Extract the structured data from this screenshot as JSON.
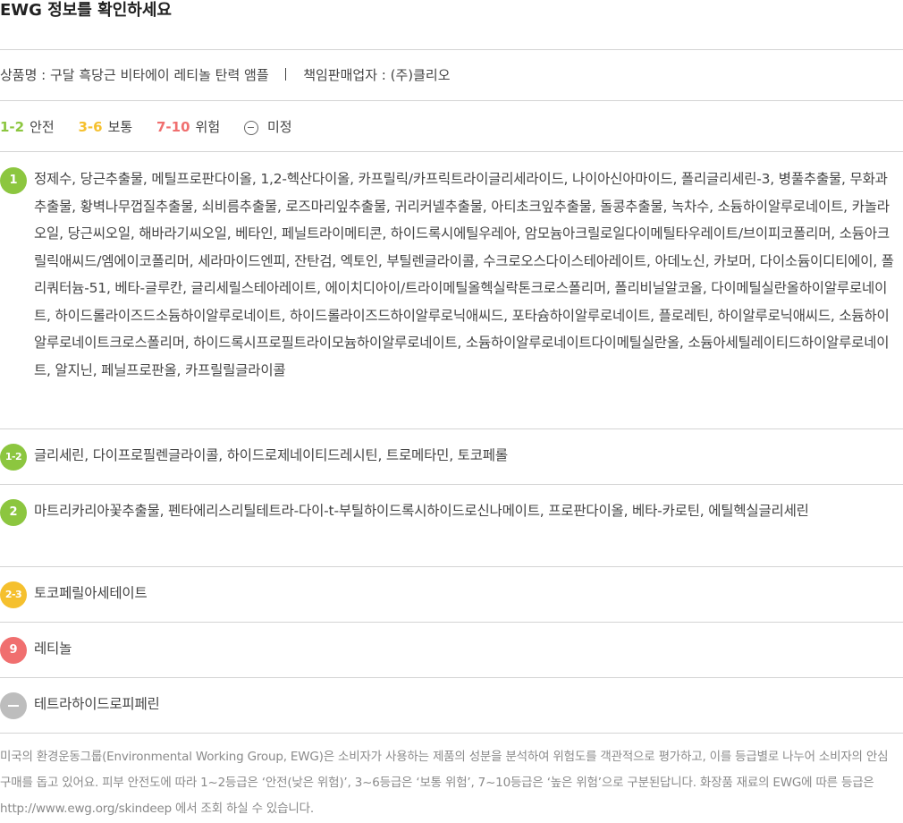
{
  "title": "EWG 정보를 확인하세요",
  "product": {
    "name": "상품명 : 구달 흑당근 비타에이 레티놀 탄력 앰플",
    "seller": "책임판매업자 : (주)클리오"
  },
  "legend": [
    {
      "range": "1-2",
      "label": "안전",
      "color": "#8cc63f"
    },
    {
      "range": "3-6",
      "label": "보통",
      "color": "#f5c02e"
    },
    {
      "range": "7-10",
      "label": "위험",
      "color": "#f06f6f"
    },
    {
      "range": "",
      "label": "미정",
      "color": "#666666",
      "icon": "minus-circle-icon"
    }
  ],
  "groups": [
    {
      "grade": "1",
      "color": "#8cc63f",
      "ingredients": "정제수, 당근추출물, 메틸프로판다이올, 1,2-헥산다이올, 카프릴릭/카프릭트라이글리세라이드, 나이아신아마이드, 폴리글리세린-3, 병풀추출물, 무화과추출물, 황벽나무껍질추출물, 쇠비름추출물, 로즈마리잎추출물, 귀리커넬추출물, 아티초크잎추출물, 돌콩추출물, 녹차수, 소듐하이알루로네이트, 카놀라오일, 당근씨오일, 해바라기씨오일, 베타인, 페닐트라이메티콘, 하이드록시에틸우레아, 암모늄아크릴로일다이메틸타우레이트/브이피코폴리머, 소듐아크릴릭애씨드/엠에이코폴리머, 세라마이드엔피, 잔탄검, 엑토인, 부틸렌글라이콜, 수크로오스다이스테아레이트, 아데노신, 카보머, 다이소듐이디티에이, 폴리쿼터늄-51, 베타-글루칸, 글리세릴스테아레이트, 에이치디아이/트라이메틸올헥실락톤크로스폴리머, 폴리비닐알코올, 다이메틸실란올하이알루로네이트, 하이드롤라이즈드소듐하이알루로네이트, 하이드롤라이즈드하이알루로닉애씨드, 포타슘하이알루로네이트, 플로레틴, 하이알루로닉애씨드, 소듐하이알루로네이트크로스폴리머, 하이드록시프로필트라이모늄하이알루로네이트, 소듐하이알루로네이트다이메틸실란올, 소듐아세틸레이티드하이알루로네이트, 알지닌, 페닐프로판올, 카프릴릴글라이콜"
    },
    {
      "grade": "1-2",
      "color": "#8cc63f",
      "ingredients": "글리세린, 다이프로필렌글라이콜, 하이드로제네이티드레시틴, 트로메타민, 토코페롤"
    },
    {
      "grade": "2",
      "color": "#8cc63f",
      "ingredients": "마트리카리아꽃추출물, 펜타에리스리틸테트라-다이-t-부틸하이드록시하이드로신나메이트, 프로판다이올, 베타-카로틴, 에틸헥실글리세린"
    },
    {
      "grade": "2-3",
      "color": "#f5c02e",
      "ingredients": "토코페릴아세테이트"
    },
    {
      "grade": "9",
      "color": "#f06f6f",
      "ingredients": "레티놀"
    },
    {
      "grade": "",
      "color": "#bdbdbd",
      "icon": "minus-icon",
      "ingredients": "테트라하이드로피페린"
    }
  ],
  "footnote": "미국의 환경운동그룹(Environmental Working Group, EWG)은 소비자가 사용하는 제품의 성분을 분석하여 위험도를 객관적으로 평가하고, 이를 등급별로 나누어 소비자의 안심 구매를 돕고 있어요. 피부 안전도에 따라 1~2등급은 ‘안전(낮은 위험)’, 3~6등급은 ‘보통 위험’, 7~10등급은 ‘높은 위험’으로 구분된답니다. 화장품 재료의 EWG에 따른 등급은 http://www.ewg.org/skindeep 에서 조회 하실 수 있습니다."
}
